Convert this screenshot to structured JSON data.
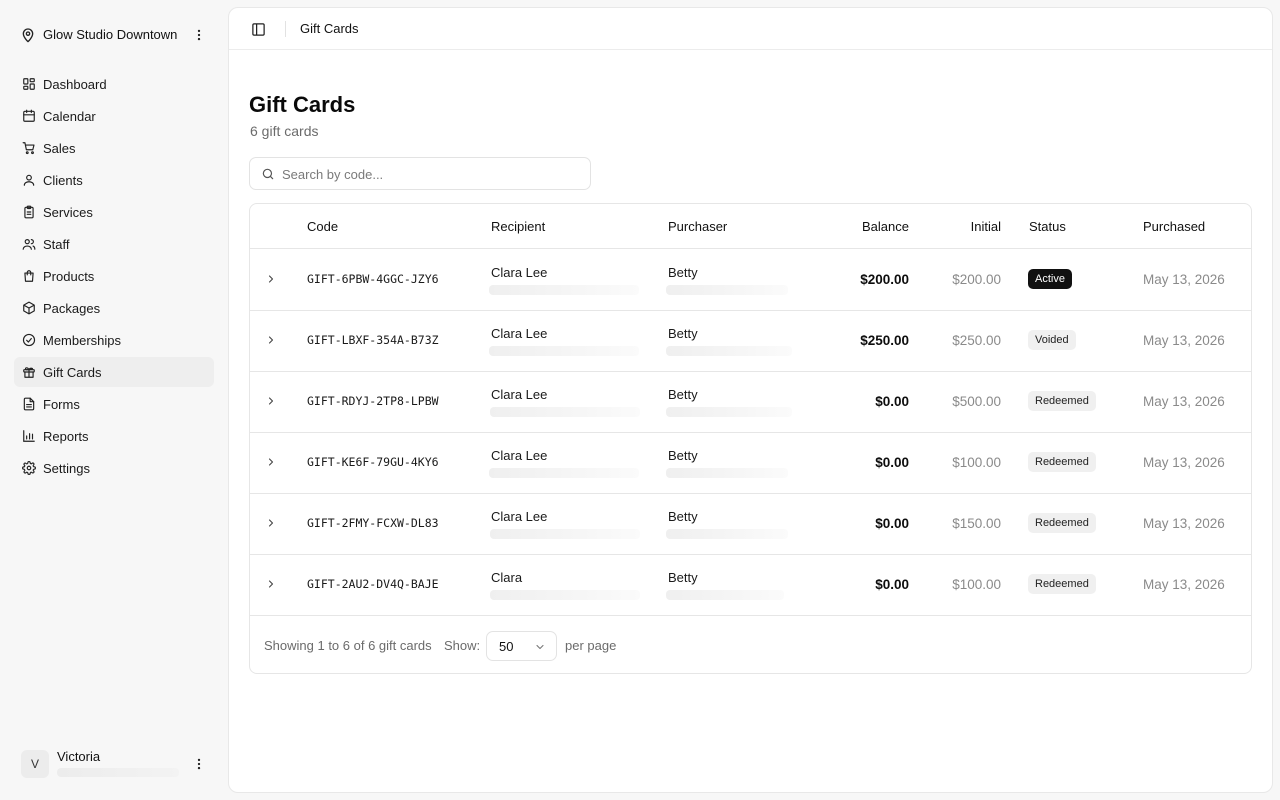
{
  "workspace": {
    "name": "Glow Studio Downtown"
  },
  "sidebar": {
    "items": [
      {
        "label": "Dashboard",
        "icon": "dashboard-icon"
      },
      {
        "label": "Calendar",
        "icon": "calendar-icon"
      },
      {
        "label": "Sales",
        "icon": "cart-icon"
      },
      {
        "label": "Clients",
        "icon": "user-icon"
      },
      {
        "label": "Services",
        "icon": "clipboard-icon"
      },
      {
        "label": "Staff",
        "icon": "users-icon"
      },
      {
        "label": "Products",
        "icon": "bag-icon"
      },
      {
        "label": "Packages",
        "icon": "package-icon"
      },
      {
        "label": "Memberships",
        "icon": "check-circle-icon"
      },
      {
        "label": "Gift Cards",
        "icon": "gift-icon",
        "active": true
      },
      {
        "label": "Forms",
        "icon": "file-icon"
      },
      {
        "label": "Reports",
        "icon": "bar-chart-icon"
      },
      {
        "label": "Settings",
        "icon": "gear-icon"
      }
    ]
  },
  "user": {
    "initial": "V",
    "name": "Victoria"
  },
  "header": {
    "breadcrumb": "Gift Cards"
  },
  "page": {
    "title": "Gift Cards",
    "subtitle": "6 gift cards",
    "search_placeholder": "Search by code..."
  },
  "table": {
    "columns": {
      "code": "Code",
      "recipient": "Recipient",
      "purchaser": "Purchaser",
      "balance": "Balance",
      "initial": "Initial",
      "status": "Status",
      "purchased": "Purchased"
    },
    "rows": [
      {
        "code": "GIFT-6PBW-4GGC-JZY6",
        "recipient": "Clara Lee",
        "purchaser": "Betty",
        "balance": "$200.00",
        "initial": "$200.00",
        "status": "Active",
        "purchased": "May 13, 2026"
      },
      {
        "code": "GIFT-LBXF-354A-B73Z",
        "recipient": "Clara Lee",
        "purchaser": "Betty",
        "balance": "$250.00",
        "initial": "$250.00",
        "status": "Voided",
        "purchased": "May 13, 2026"
      },
      {
        "code": "GIFT-RDYJ-2TP8-LPBW",
        "recipient": "Clara Lee",
        "purchaser": "Betty",
        "balance": "$0.00",
        "initial": "$500.00",
        "status": "Redeemed",
        "purchased": "May 13, 2026"
      },
      {
        "code": "GIFT-KE6F-79GU-4KY6",
        "recipient": "Clara Lee",
        "purchaser": "Betty",
        "balance": "$0.00",
        "initial": "$100.00",
        "status": "Redeemed",
        "purchased": "May 13, 2026"
      },
      {
        "code": "GIFT-2FMY-FCXW-DL83",
        "recipient": "Clara Lee",
        "purchaser": "Betty",
        "balance": "$0.00",
        "initial": "$150.00",
        "status": "Redeemed",
        "purchased": "May 13, 2026"
      },
      {
        "code": "GIFT-2AU2-DV4Q-BAJE",
        "recipient": "Clara",
        "purchaser": "Betty",
        "balance": "$0.00",
        "initial": "$100.00",
        "status": "Redeemed",
        "purchased": "May 13, 2026"
      }
    ],
    "footer": {
      "showing": "Showing 1 to 6 of 6 gift cards",
      "show_label": "Show:",
      "per_page_value": "50",
      "per_page_label": "per page"
    }
  }
}
